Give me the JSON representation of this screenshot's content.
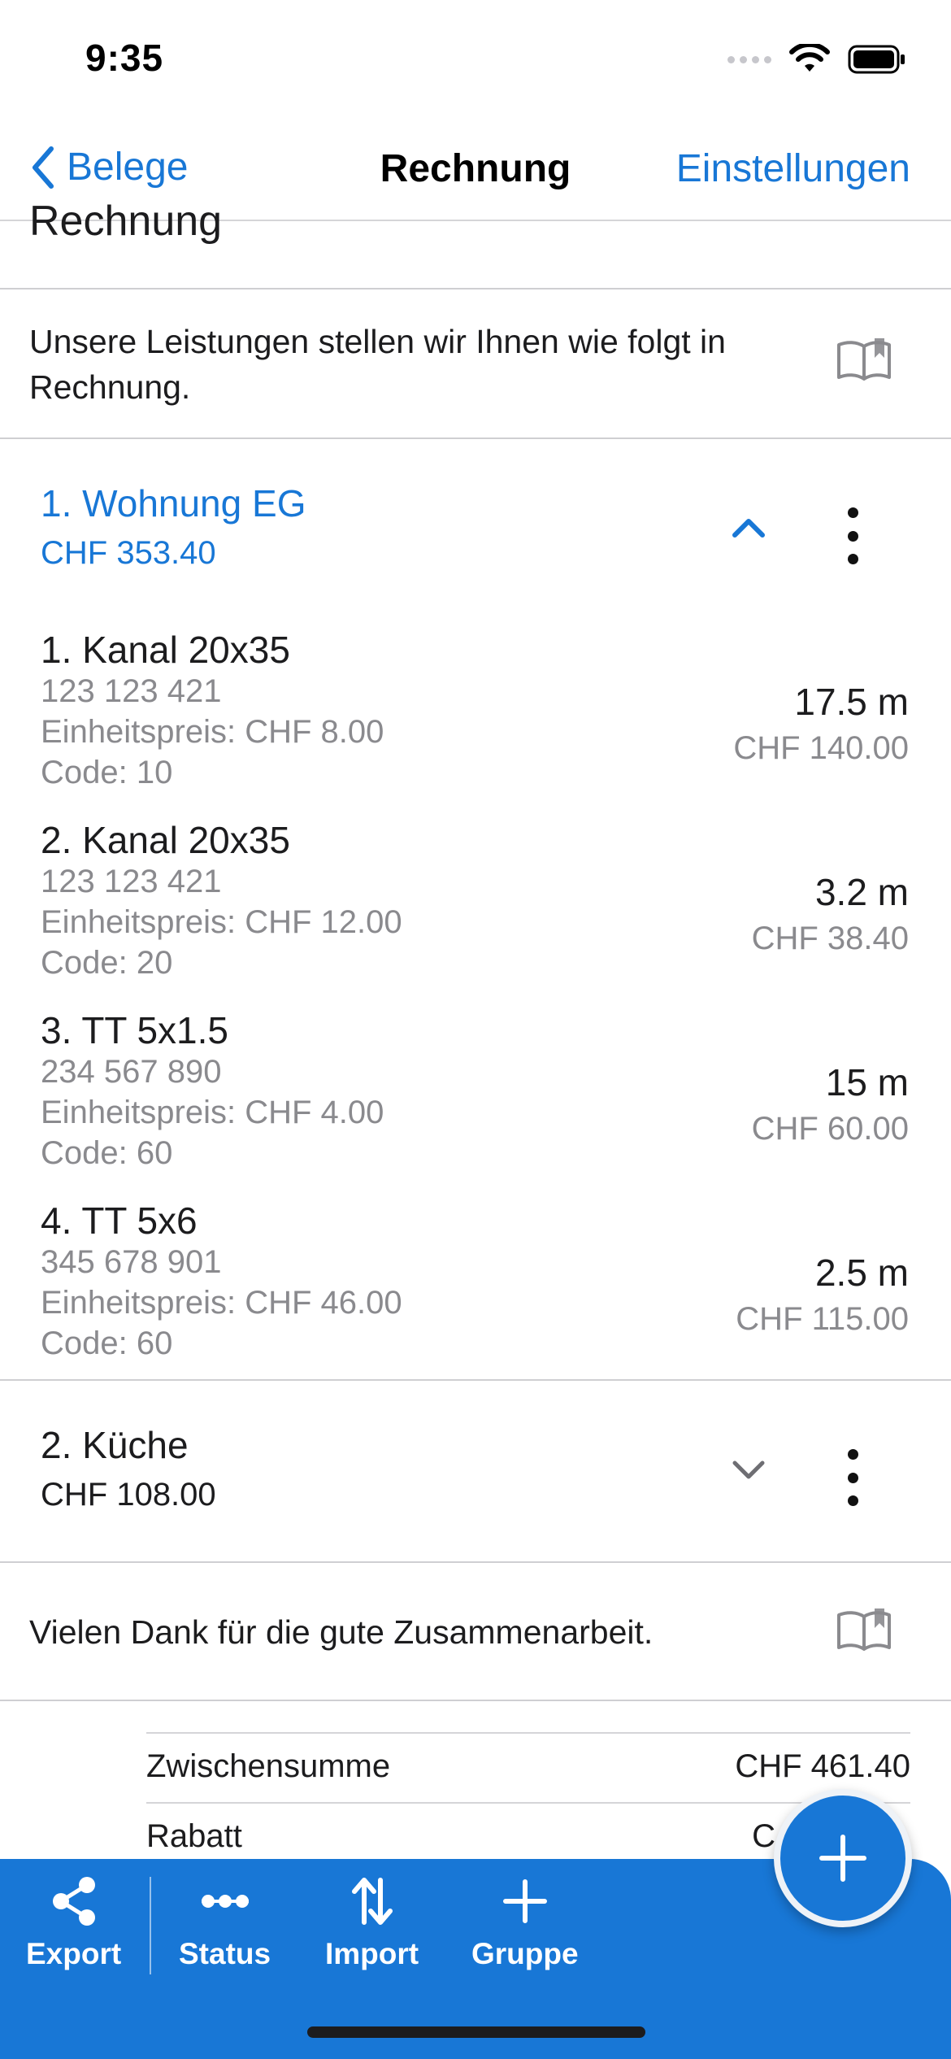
{
  "status_bar": {
    "time": "9:35"
  },
  "nav": {
    "back_label": "Belege",
    "title": "Rechnung",
    "right_label": "Einstellungen"
  },
  "section_cut_title": "Rechnung",
  "intro_text": "Unsere Leistungen stellen wir Ihnen wie folgt in Rechnung.",
  "groups": [
    {
      "title": "1. Wohnung EG",
      "amount": "CHF 353.40",
      "expanded": true,
      "items": [
        {
          "name": "1. Kanal 20x35",
          "article": "123 123 421",
          "unit_price": "Einheitspreis: CHF 8.00",
          "code": "Code: 10",
          "quantity": "17.5 m",
          "total": "CHF 140.00"
        },
        {
          "name": "2. Kanal 20x35",
          "article": "123 123 421",
          "unit_price": "Einheitspreis: CHF 12.00",
          "code": "Code: 20",
          "quantity": "3.2 m",
          "total": "CHF 38.40"
        },
        {
          "name": "3. TT 5x1.5",
          "article": "234 567 890",
          "unit_price": "Einheitspreis: CHF 4.00",
          "code": "Code: 60",
          "quantity": "15 m",
          "total": "CHF 60.00"
        },
        {
          "name": "4. TT 5x6",
          "article": "345 678 901",
          "unit_price": "Einheitspreis: CHF 46.00",
          "code": "Code: 60",
          "quantity": "2.5 m",
          "total": "CHF 115.00"
        }
      ]
    },
    {
      "title": "2. Küche",
      "amount": "CHF 108.00",
      "expanded": false,
      "items": []
    }
  ],
  "closing_text": "Vielen Dank für die gute Zusammenarbeit.",
  "summary": [
    {
      "label": "Zwischensumme",
      "value": "CHF 461.40"
    },
    {
      "label": "Rabatt",
      "value": "C"
    }
  ],
  "toolbar": {
    "export_label": "Export",
    "status_label": "Status",
    "import_label": "Import",
    "group_label": "Gruppe"
  },
  "fab_icon": "plus-icon",
  "colors": {
    "accent": "#1877d6",
    "secondary_text": "#8a8a8e",
    "divider": "#cfcfd2"
  }
}
